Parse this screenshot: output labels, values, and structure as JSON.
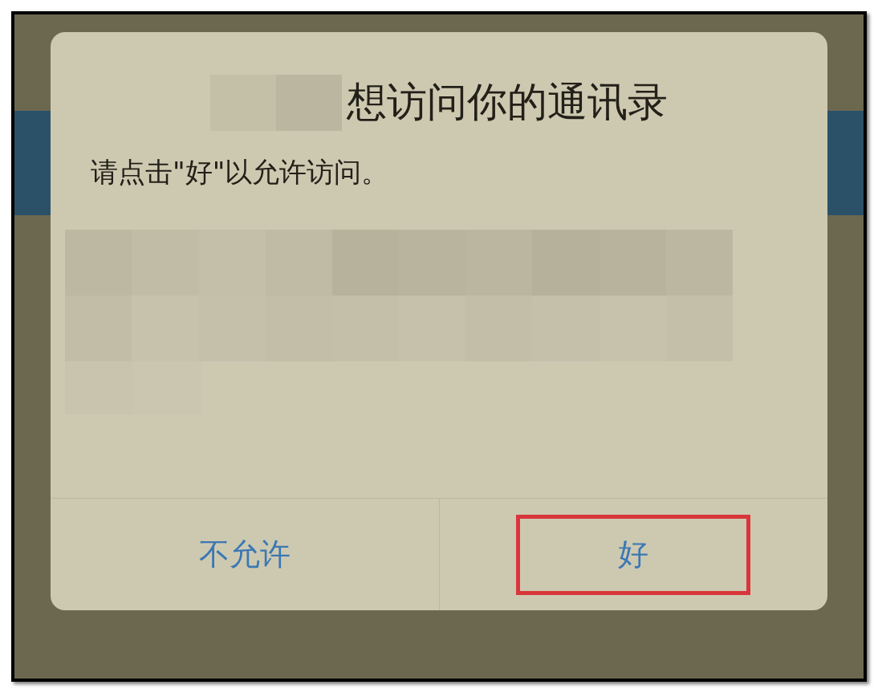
{
  "alert": {
    "title": "想访问你的通讯录",
    "message": "请点击\"好\"以允许访问。",
    "buttons": [
      {
        "label": "不允许",
        "highlighted": false
      },
      {
        "label": "好",
        "highlighted": true
      }
    ]
  }
}
